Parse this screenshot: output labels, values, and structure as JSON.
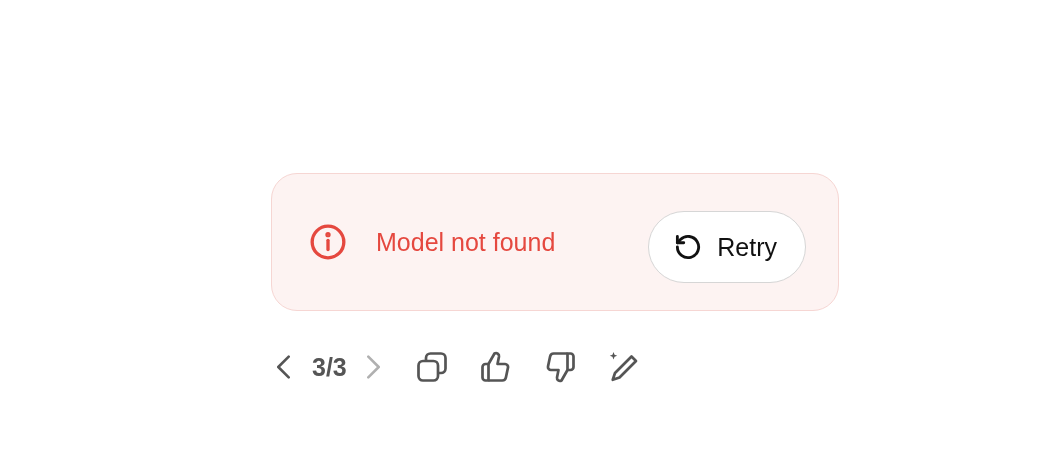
{
  "error": {
    "message": "Model not found",
    "retry_label": "Retry"
  },
  "pager": {
    "prev_disabled": false,
    "position": "3/3",
    "next_disabled": true
  },
  "actions": [
    {
      "kind": "copy"
    },
    {
      "kind": "thumbs_up"
    },
    {
      "kind": "thumbs_down"
    },
    {
      "kind": "edit"
    }
  ]
}
